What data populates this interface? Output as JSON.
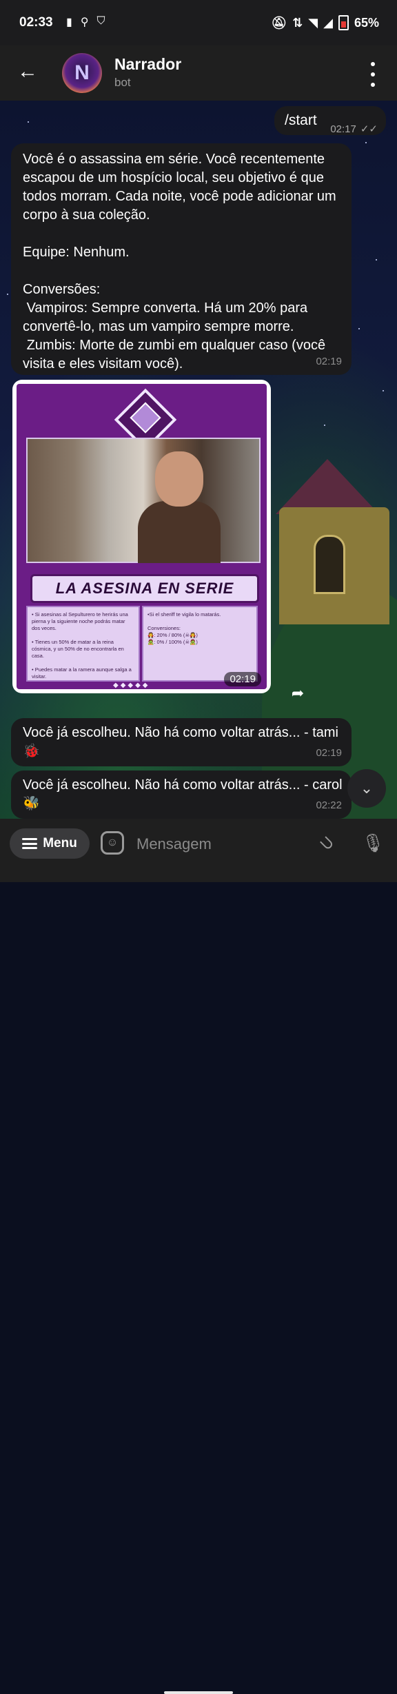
{
  "status_bar": {
    "time": "02:33",
    "left_icons": [
      "sim-icon",
      "no-notification-icon",
      "shield-icon"
    ],
    "battery": "65%"
  },
  "header": {
    "title": "Narrador",
    "subtitle": "bot",
    "avatar_letter": "N"
  },
  "messages": [
    {
      "type": "outgoing",
      "text": "/start",
      "time": "02:17",
      "status": "read"
    },
    {
      "type": "incoming",
      "text": "Você é o assassina em série. Você recentemente escapou de um hospício local, seu objetivo é que todos morram. Cada noite, você pode adicionar um corpo à sua coleção.\n\nEquipe: Nenhum.\n\nConversões:\n Vampiros: Sempre converta. Há um 20% para convertê-lo, mas um vampiro sempre morre.\n Zumbis: Morte de zumbi em qualquer caso (você visita e eles visitam você).",
      "time": "02:19"
    },
    {
      "type": "image",
      "time": "02:19",
      "card": {
        "title": "LA ASESINA EN SERIE",
        "left_text": "• Si asesinas al Sepulturero te herirás una pierna y la siguiente noche podrás matar dos veces.\n\n• Tienes un 50% de matar a la reina cósmica, y un 50% de no encontrarla en casa.\n\n• Puedes matar a la ramera aunque salga a visitar.",
        "right_text": "•Si el sheriff te vigila lo matarás.\n\nConversiones:\n🧛: 20% / 80% (☠🧛)\n🧟: 0% / 100% (☠🧟)"
      }
    },
    {
      "type": "incoming",
      "text": "Você já escolheu. Não há como voltar atrás... - tami 🐞",
      "time": "02:19"
    },
    {
      "type": "incoming",
      "text": "Você já escolheu. Não há como voltar atrás... - carol 🐝",
      "time": "02:22"
    }
  ],
  "input_bar": {
    "menu_label": "Menu",
    "placeholder": "Mensagem"
  }
}
